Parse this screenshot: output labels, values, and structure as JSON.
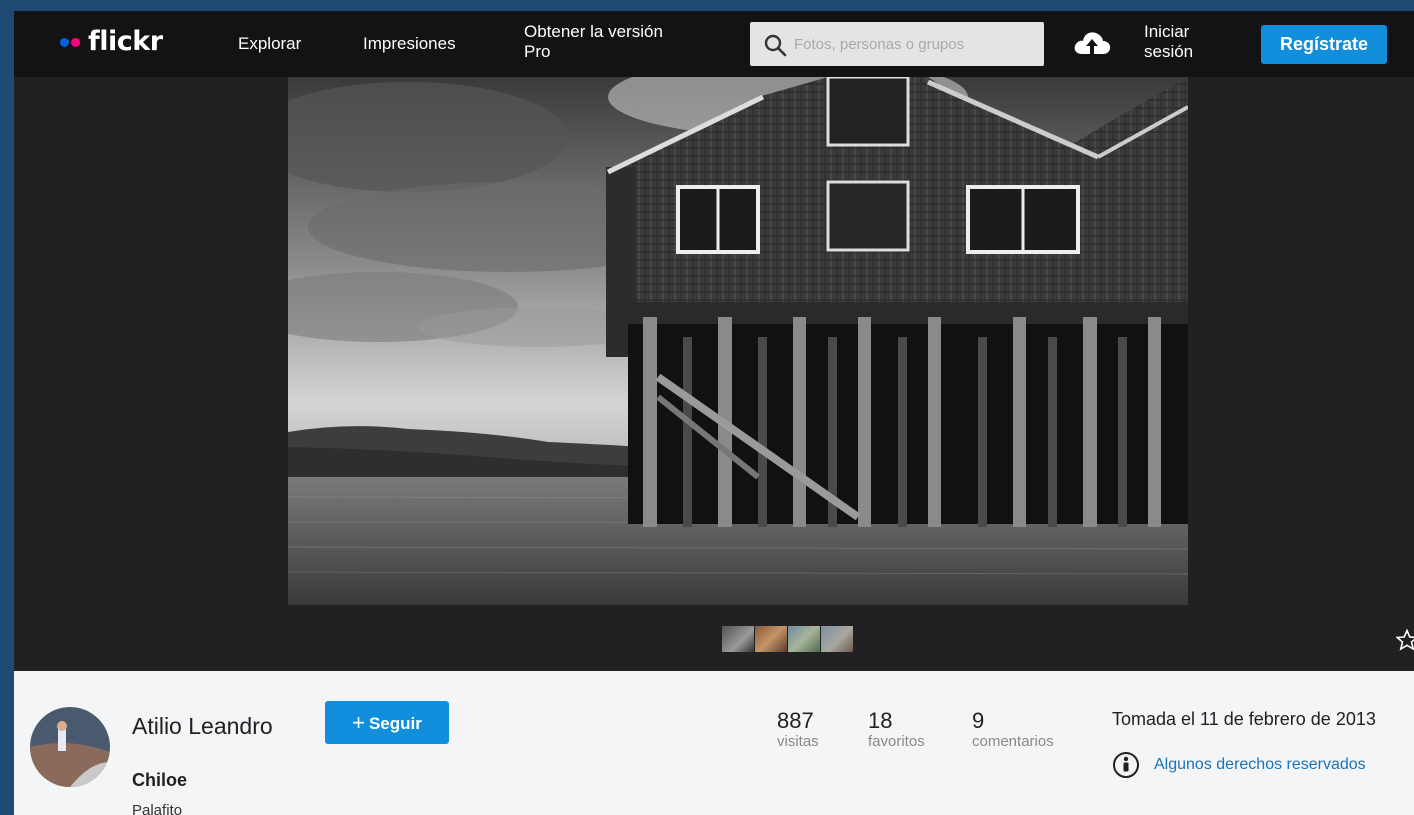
{
  "nav": {
    "brand": "flickr",
    "links": [
      "Explorar",
      "Impresiones"
    ],
    "pro_line1": "Obtener la versión",
    "pro_line2": "Pro",
    "search_placeholder": "Fotos, personas o grupos",
    "login_line1": "Iniciar",
    "login_line2": "sesión",
    "signup_label": "Regístrate",
    "colors": {
      "dot_blue": "#0063dc",
      "dot_pink": "#ff0084",
      "accent": "#128fdc"
    },
    "icons": [
      "search-icon",
      "upload-cloud-icon"
    ]
  },
  "photo": {
    "thumbnails": 4,
    "icons": [
      "favorite-star-icon"
    ]
  },
  "info": {
    "author": "Atilio Leandro",
    "follow_label": "Seguir",
    "title": "Chiloe",
    "description": "Palafito",
    "stats": [
      {
        "value": "887",
        "label": "visitas"
      },
      {
        "value": "18",
        "label": "favoritos"
      },
      {
        "value": "9",
        "label": "comentarios"
      }
    ],
    "taken": "Tomada el 11 de febrero de 2013",
    "license": "Algunos derechos reservados",
    "icons": [
      "avatar",
      "license-info-icon"
    ]
  }
}
